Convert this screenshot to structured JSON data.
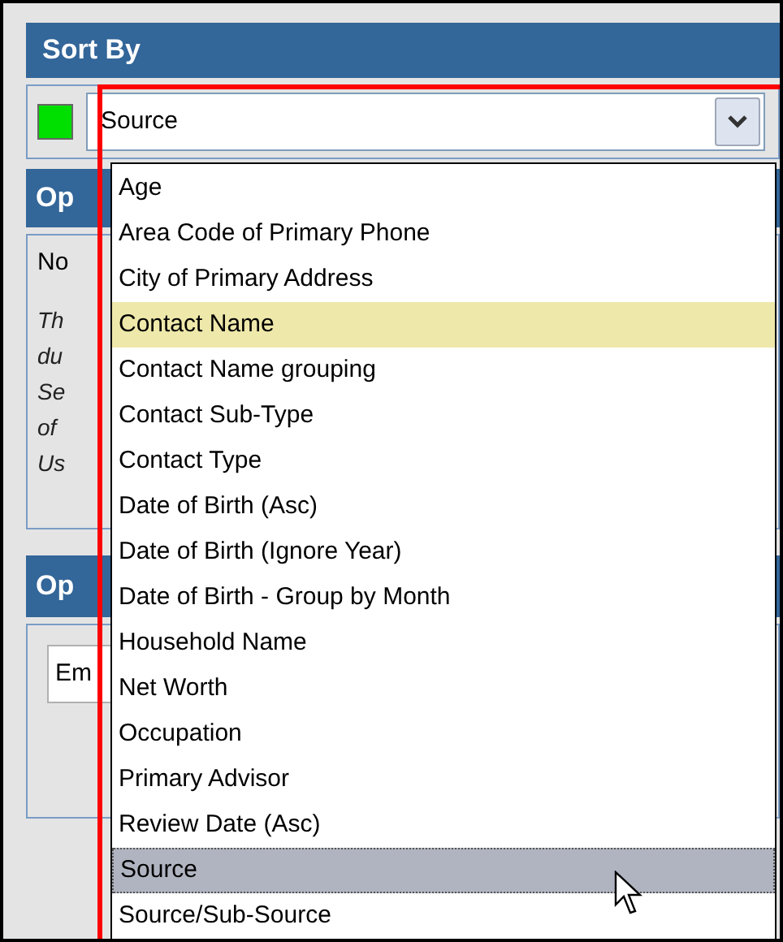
{
  "sort_panel": {
    "title": "Sort By",
    "enabled": true,
    "select": {
      "value": "Source"
    }
  },
  "options_panel": {
    "title": "Op",
    "first_line": "No",
    "note_lines": [
      "Th",
      "du",
      "Se",
      "of",
      "Us"
    ]
  },
  "options_panel_2": {
    "title": "Op",
    "field_value": "Em"
  },
  "dropdown_items": [
    {
      "label": "Age",
      "selected": false,
      "highlighted": false
    },
    {
      "label": "Area Code of Primary Phone",
      "selected": false,
      "highlighted": false
    },
    {
      "label": "City of Primary Address",
      "selected": false,
      "highlighted": false
    },
    {
      "label": "Contact Name",
      "selected": false,
      "highlighted": true
    },
    {
      "label": "Contact Name grouping",
      "selected": false,
      "highlighted": false
    },
    {
      "label": "Contact Sub-Type",
      "selected": false,
      "highlighted": false
    },
    {
      "label": "Contact Type",
      "selected": false,
      "highlighted": false
    },
    {
      "label": "Date of Birth (Asc)",
      "selected": false,
      "highlighted": false
    },
    {
      "label": "Date of Birth (Ignore Year)",
      "selected": false,
      "highlighted": false
    },
    {
      "label": "Date of Birth - Group by Month",
      "selected": false,
      "highlighted": false
    },
    {
      "label": "Household Name",
      "selected": false,
      "highlighted": false
    },
    {
      "label": "Net Worth",
      "selected": false,
      "highlighted": false
    },
    {
      "label": "Occupation",
      "selected": false,
      "highlighted": false
    },
    {
      "label": "Primary Advisor",
      "selected": false,
      "highlighted": false
    },
    {
      "label": "Review Date (Asc)",
      "selected": false,
      "highlighted": false
    },
    {
      "label": "Source",
      "selected": true,
      "highlighted": false
    },
    {
      "label": "Source/Sub-Source",
      "selected": false,
      "highlighted": false
    }
  ]
}
